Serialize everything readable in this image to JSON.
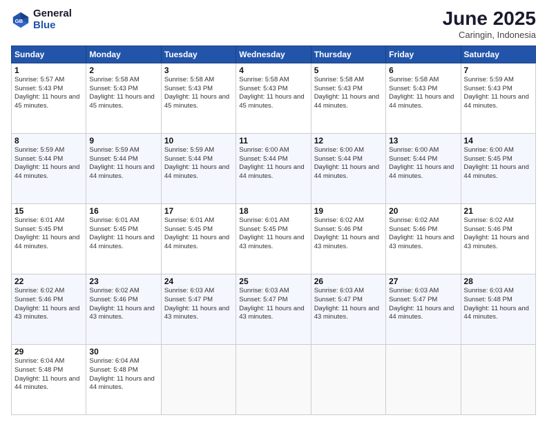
{
  "header": {
    "logo_line1": "General",
    "logo_line2": "Blue",
    "month_year": "June 2025",
    "location": "Caringin, Indonesia"
  },
  "weekdays": [
    "Sunday",
    "Monday",
    "Tuesday",
    "Wednesday",
    "Thursday",
    "Friday",
    "Saturday"
  ],
  "weeks": [
    [
      {
        "day": "1",
        "sunrise": "5:57 AM",
        "sunset": "5:43 PM",
        "daylight": "11 hours and 45 minutes."
      },
      {
        "day": "2",
        "sunrise": "5:58 AM",
        "sunset": "5:43 PM",
        "daylight": "11 hours and 45 minutes."
      },
      {
        "day": "3",
        "sunrise": "5:58 AM",
        "sunset": "5:43 PM",
        "daylight": "11 hours and 45 minutes."
      },
      {
        "day": "4",
        "sunrise": "5:58 AM",
        "sunset": "5:43 PM",
        "daylight": "11 hours and 45 minutes."
      },
      {
        "day": "5",
        "sunrise": "5:58 AM",
        "sunset": "5:43 PM",
        "daylight": "11 hours and 44 minutes."
      },
      {
        "day": "6",
        "sunrise": "5:58 AM",
        "sunset": "5:43 PM",
        "daylight": "11 hours and 44 minutes."
      },
      {
        "day": "7",
        "sunrise": "5:59 AM",
        "sunset": "5:43 PM",
        "daylight": "11 hours and 44 minutes."
      }
    ],
    [
      {
        "day": "8",
        "sunrise": "5:59 AM",
        "sunset": "5:44 PM",
        "daylight": "11 hours and 44 minutes."
      },
      {
        "day": "9",
        "sunrise": "5:59 AM",
        "sunset": "5:44 PM",
        "daylight": "11 hours and 44 minutes."
      },
      {
        "day": "10",
        "sunrise": "5:59 AM",
        "sunset": "5:44 PM",
        "daylight": "11 hours and 44 minutes."
      },
      {
        "day": "11",
        "sunrise": "6:00 AM",
        "sunset": "5:44 PM",
        "daylight": "11 hours and 44 minutes."
      },
      {
        "day": "12",
        "sunrise": "6:00 AM",
        "sunset": "5:44 PM",
        "daylight": "11 hours and 44 minutes."
      },
      {
        "day": "13",
        "sunrise": "6:00 AM",
        "sunset": "5:44 PM",
        "daylight": "11 hours and 44 minutes."
      },
      {
        "day": "14",
        "sunrise": "6:00 AM",
        "sunset": "5:45 PM",
        "daylight": "11 hours and 44 minutes."
      }
    ],
    [
      {
        "day": "15",
        "sunrise": "6:01 AM",
        "sunset": "5:45 PM",
        "daylight": "11 hours and 44 minutes."
      },
      {
        "day": "16",
        "sunrise": "6:01 AM",
        "sunset": "5:45 PM",
        "daylight": "11 hours and 44 minutes."
      },
      {
        "day": "17",
        "sunrise": "6:01 AM",
        "sunset": "5:45 PM",
        "daylight": "11 hours and 44 minutes."
      },
      {
        "day": "18",
        "sunrise": "6:01 AM",
        "sunset": "5:45 PM",
        "daylight": "11 hours and 43 minutes."
      },
      {
        "day": "19",
        "sunrise": "6:02 AM",
        "sunset": "5:46 PM",
        "daylight": "11 hours and 43 minutes."
      },
      {
        "day": "20",
        "sunrise": "6:02 AM",
        "sunset": "5:46 PM",
        "daylight": "11 hours and 43 minutes."
      },
      {
        "day": "21",
        "sunrise": "6:02 AM",
        "sunset": "5:46 PM",
        "daylight": "11 hours and 43 minutes."
      }
    ],
    [
      {
        "day": "22",
        "sunrise": "6:02 AM",
        "sunset": "5:46 PM",
        "daylight": "11 hours and 43 minutes."
      },
      {
        "day": "23",
        "sunrise": "6:02 AM",
        "sunset": "5:46 PM",
        "daylight": "11 hours and 43 minutes."
      },
      {
        "day": "24",
        "sunrise": "6:03 AM",
        "sunset": "5:47 PM",
        "daylight": "11 hours and 43 minutes."
      },
      {
        "day": "25",
        "sunrise": "6:03 AM",
        "sunset": "5:47 PM",
        "daylight": "11 hours and 43 minutes."
      },
      {
        "day": "26",
        "sunrise": "6:03 AM",
        "sunset": "5:47 PM",
        "daylight": "11 hours and 43 minutes."
      },
      {
        "day": "27",
        "sunrise": "6:03 AM",
        "sunset": "5:47 PM",
        "daylight": "11 hours and 44 minutes."
      },
      {
        "day": "28",
        "sunrise": "6:03 AM",
        "sunset": "5:48 PM",
        "daylight": "11 hours and 44 minutes."
      }
    ],
    [
      {
        "day": "29",
        "sunrise": "6:04 AM",
        "sunset": "5:48 PM",
        "daylight": "11 hours and 44 minutes."
      },
      {
        "day": "30",
        "sunrise": "6:04 AM",
        "sunset": "5:48 PM",
        "daylight": "11 hours and 44 minutes."
      },
      null,
      null,
      null,
      null,
      null
    ]
  ]
}
